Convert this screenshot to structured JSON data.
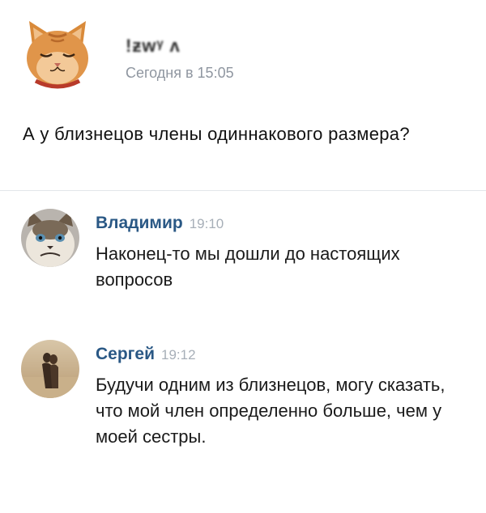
{
  "post": {
    "author": "!ƶᴡᵞ ʌ",
    "time": "Сегодня в 15:05",
    "text": "А у близнецов члены одиннакового размера?"
  },
  "comments": [
    {
      "author": "Владимир",
      "time": "19:10",
      "text": "Наконец-то мы дошли до настоящих вопросов"
    },
    {
      "author": "Сергей",
      "time": "19:12",
      "text": "Будучи одним из близнецов, могу сказать, что мой член определенно больше, чем у моей сестры."
    }
  ],
  "colors": {
    "link": "#2a5885",
    "meta": "#8f96a0",
    "divider": "#e3e6ea"
  }
}
